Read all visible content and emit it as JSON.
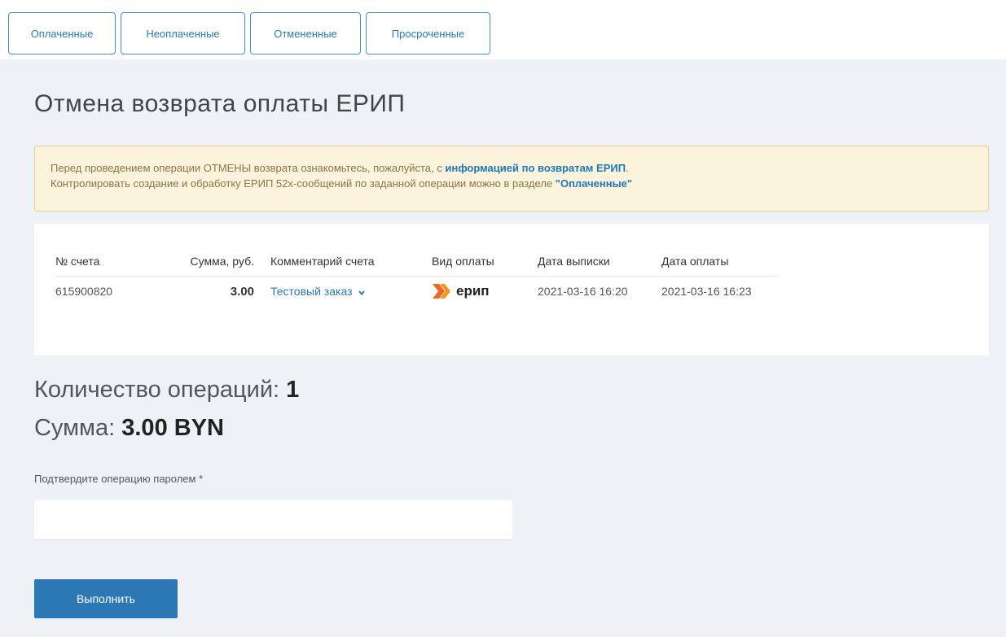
{
  "tabs": [
    {
      "label": "Оплаченные"
    },
    {
      "label": "Неоплаченные"
    },
    {
      "label": "Отмененные"
    },
    {
      "label": "Просроченные"
    }
  ],
  "page_title": "Отмена возврата оплаты ЕРИП",
  "alert": {
    "line1_prefix": "Перед проведением операции ОТМЕНЫ возврата ознакомьтесь, пожалуйста, с ",
    "line1_link": "информацией по возвратам ЕРИП",
    "line1_suffix": ".",
    "line2_prefix": "Контролировать создание и обработку ЕРИП 52x-сообщений по заданной операции можно в разделе ",
    "line2_link": "\"Оплаченные\""
  },
  "table": {
    "headers": [
      "№ счета",
      "Сумма, руб.",
      "Комментарий счета",
      "Вид оплаты",
      "Дата выписки",
      "Дата оплаты"
    ],
    "rows": [
      {
        "invoice": "615900820",
        "amount": "3.00",
        "comment": "Тестовый заказ",
        "payment_type": "ерип",
        "issue_date": "2021-03-16 16:20",
        "pay_date": "2021-03-16 16:23"
      }
    ]
  },
  "summary": {
    "count_label": "Количество операций: ",
    "count_value": "1",
    "sum_label": "Сумма: ",
    "sum_value": "3.00 BYN"
  },
  "password": {
    "label": "Подтвердите операцию паролем *",
    "value": ""
  },
  "submit_label": "Выполнить",
  "colors": {
    "accent": "#2b78b5",
    "alert_bg": "#fcf3dc",
    "erip_orange": "#f26522"
  }
}
